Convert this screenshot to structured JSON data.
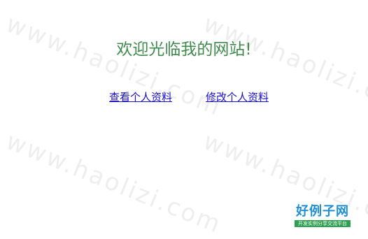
{
  "page": {
    "title": "欢迎光临我的网站!",
    "links": {
      "view_profile": "查看个人资料",
      "edit_profile": "修改个人资料"
    }
  },
  "watermark": {
    "text": "www.haolizi.com"
  },
  "logo": {
    "main": "好例子网",
    "sub": "开发实例分享交流平台"
  },
  "colors": {
    "title": "#3f8a4d",
    "link": "#1a0fc8",
    "watermark": "#eeeeee",
    "logo_main": "#1e8fd6",
    "logo_sub_bg": "#2f9f52"
  }
}
